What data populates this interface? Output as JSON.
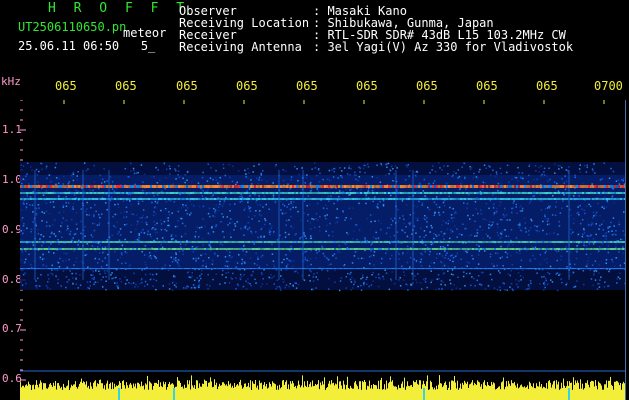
{
  "header": {
    "title": "H R O F F T",
    "filename": "UT2506110650.pn",
    "meteor": "meteor",
    "datetime": "25.06.11 06:50   5_",
    "fields": [
      {
        "label": "Observer",
        "value": ": Masaki Kano"
      },
      {
        "label": "Receiving Location",
        "value": ": Shibukawa, Gunma, Japan"
      },
      {
        "label": "Receiver",
        "value": ": RTL-SDR SDR# 43dB L15 103.2MHz CW"
      },
      {
        "label": "Receiving Antenna",
        "value": ": 3el Yagi(V) Az 330 for Vladivostok"
      }
    ]
  },
  "axis": {
    "y_unit": "kHz",
    "y_ticks": [
      "1.1",
      "1.0",
      "0.9",
      "0.8",
      "0.7",
      "0.6"
    ],
    "x_ticks": [
      "065",
      "065",
      "065",
      "065",
      "065",
      "065",
      "065",
      "065",
      "065",
      "0700"
    ]
  },
  "colors": {
    "background": "#000000",
    "header_green": "#33e633",
    "header_white": "#ffffff",
    "tick_yellow": "#f2ee3a",
    "axis_pink": "#ff99cc",
    "signal_low": "#0a2f9a",
    "signal_mid": "#1f8fe8",
    "signal_high": "#ff2a2a",
    "amplitude_bar": "#f2ee3a"
  },
  "icons": {
    "spectrogram": "spectrogram-plot",
    "amplitude": "amplitude-strip"
  }
}
